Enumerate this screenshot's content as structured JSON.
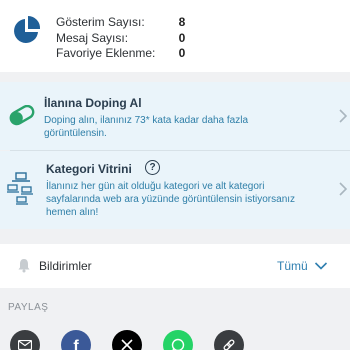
{
  "stats": {
    "items": [
      {
        "label": "Gösterim Sayısı:",
        "value": "8"
      },
      {
        "label": "Mesaj Sayısı:",
        "value": "0"
      },
      {
        "label": "Favoriye Eklenme:",
        "value": "0"
      }
    ]
  },
  "doping": {
    "title": "İlanına Doping Al",
    "desc_line1": "Doping alın, ilanınız 73* kata kadar daha fazla",
    "desc_line2": "görüntülensin."
  },
  "vitrin": {
    "title": "Kategori Vitrini",
    "desc_line1": "İlanınız her gün ait olduğu kategori ve alt kategori",
    "desc_line2": "sayfalarında web ara yüzünde görüntülensin istiyorsanız",
    "desc_line3": "hemen alın!"
  },
  "notifications": {
    "label": "Bildirimler",
    "value": "Tümü"
  },
  "share": {
    "label": "PAYLAŞ",
    "buttons": [
      {
        "icon": "mail-icon",
        "color": "#3a3d40"
      },
      {
        "icon": "facebook-icon",
        "color": "#3b5998"
      },
      {
        "icon": "x-icon",
        "color": "#000000"
      },
      {
        "icon": "whatsapp-icon",
        "color": "#25d366"
      },
      {
        "icon": "link-icon",
        "color": "#3a3d40"
      }
    ]
  },
  "colors": {
    "accent": "#2f7fb0",
    "promo_bg": "#eaf4fa",
    "page_bg": "#f0f1f3"
  }
}
